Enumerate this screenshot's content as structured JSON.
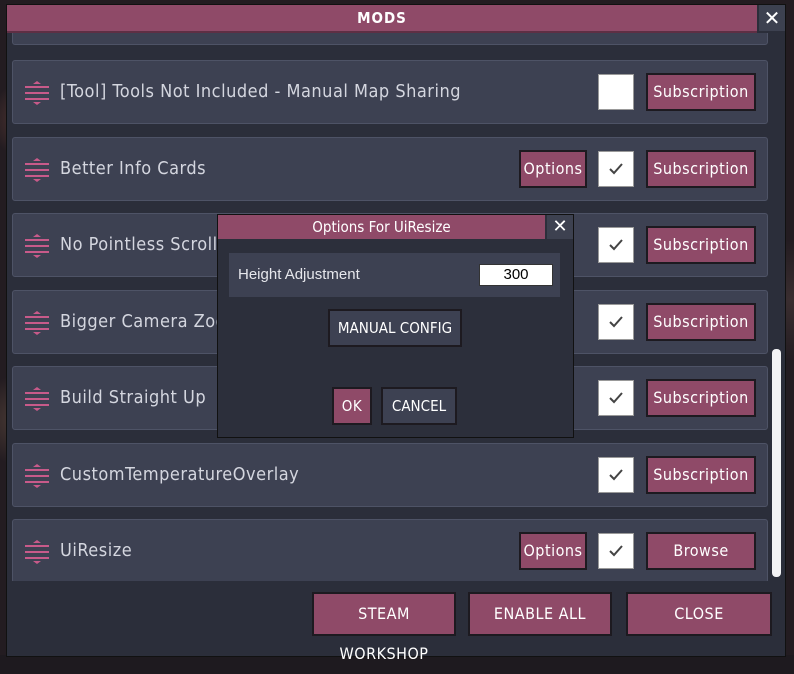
{
  "window": {
    "title": "MODS",
    "close_glyph": "✕"
  },
  "mods": [
    {
      "label": "",
      "has_options": false,
      "checked": false,
      "action_label": ""
    },
    {
      "label": "[Tool] Tools Not Included - Manual Map Sharing",
      "has_options": false,
      "checked": false,
      "action_label": "Subscription"
    },
    {
      "label": "Better Info Cards",
      "has_options": true,
      "options_label": "Options",
      "checked": true,
      "action_label": "Subscription"
    },
    {
      "label": "No Pointless Scrollb",
      "has_options": false,
      "checked": true,
      "action_label": "Subscription"
    },
    {
      "label": "Bigger Camera Zoon",
      "has_options": false,
      "checked": true,
      "action_label": "Subscription"
    },
    {
      "label": "Build Straight Up",
      "has_options": false,
      "checked": true,
      "action_label": "Subscription"
    },
    {
      "label": "CustomTemperatureOverlay",
      "has_options": false,
      "checked": true,
      "action_label": "Subscription"
    },
    {
      "label": "UiResize",
      "has_options": true,
      "options_label": "Options",
      "checked": true,
      "action_label": "Browse"
    }
  ],
  "scroll": {
    "position": 0.9
  },
  "footer": {
    "steam_workshop": "STEAM WORKSHOP",
    "enable_all": "ENABLE ALL",
    "close": "CLOSE"
  },
  "dialog": {
    "title": "Options For UiResize",
    "close_glyph": "✕",
    "field_label": "Height Adjustment",
    "field_value": "300",
    "manual_config": "MANUAL CONFIG",
    "ok": "OK",
    "cancel": "CANCEL"
  },
  "icons": {
    "drag": "drag-handle-icon",
    "check": "check-icon",
    "close": "close-icon"
  },
  "colors": {
    "accent": "#8f4a68",
    "panel": "#2b2e3a",
    "row": "#3d4152",
    "handle": "#c85a8a"
  }
}
